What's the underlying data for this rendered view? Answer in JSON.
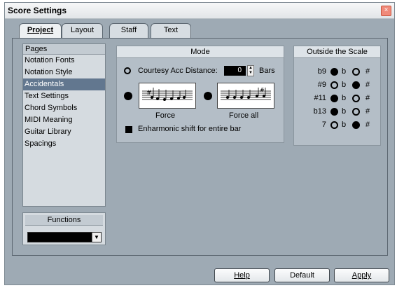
{
  "window": {
    "title": "Score Settings",
    "close_glyph": "×"
  },
  "tabs": [
    {
      "label": "Project",
      "active": true
    },
    {
      "label": "Layout",
      "active": false
    },
    {
      "label": "Staff",
      "active": false
    },
    {
      "label": "Text",
      "active": false
    }
  ],
  "pages": {
    "header": "Pages",
    "items": [
      "Notation Fonts",
      "Notation Style",
      "Accidentals",
      "Text Settings",
      "Chord Symbols",
      "MIDI Meaning",
      "Guitar Library",
      "Spacings"
    ],
    "selected": "Accidentals"
  },
  "functions": {
    "header": "Functions",
    "value": ""
  },
  "mode": {
    "header": "Mode",
    "courtesy_label": "Courtesy Acc Distance:",
    "courtesy_value": "0",
    "courtesy_unit": "Bars",
    "force_label": "Force",
    "force_all_label": "Force all",
    "enharmonic_label": "Enharmonic shift for entire bar"
  },
  "outside_scale": {
    "header": "Outside the Scale",
    "rows": [
      {
        "label": "b9",
        "flat_selected": true
      },
      {
        "label": "#9",
        "flat_selected": false
      },
      {
        "label": "#11",
        "flat_selected": true
      },
      {
        "label": "b13",
        "flat_selected": true
      },
      {
        "label": "7",
        "flat_selected": false
      }
    ],
    "flat_symbol": "b",
    "sharp_symbol": "#"
  },
  "buttons": {
    "help": "Help",
    "default": "Default",
    "apply": "Apply"
  },
  "icons": {
    "close": "close-icon",
    "dropdown": "chevron-down-icon"
  },
  "colors": {
    "selection": "#62778f",
    "panel": "#9eaab4"
  }
}
